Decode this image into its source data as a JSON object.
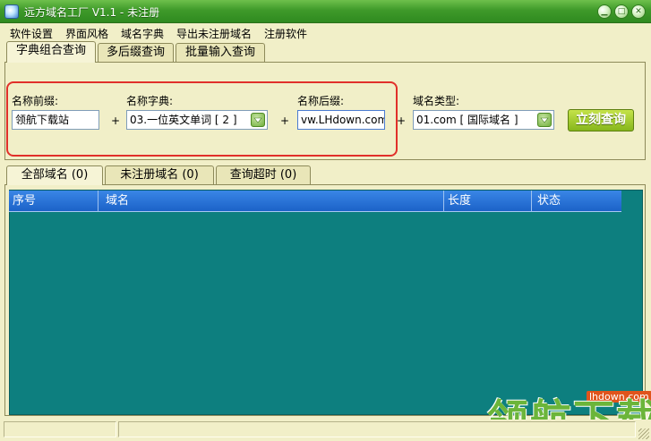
{
  "window": {
    "title": "远方域名工厂 V1.1 - 未注册",
    "icon": "app-icon",
    "buttons": [
      "minimize-icon",
      "maximize-icon",
      "close-icon"
    ]
  },
  "menu": {
    "items": [
      {
        "label": "软件设置"
      },
      {
        "label": "界面风格"
      },
      {
        "label": "域名字典"
      },
      {
        "label": "导出未注册域名"
      },
      {
        "label": "注册软件"
      }
    ]
  },
  "top_tabs": [
    {
      "label": "字典组合查询",
      "active": true
    },
    {
      "label": "多后缀查询",
      "active": false
    },
    {
      "label": "批量输入查询",
      "active": false
    }
  ],
  "form": {
    "prefix_label": "名称前缀:",
    "prefix_value": "领航下载站",
    "dict_label": "名称字典:",
    "dict_value": "03.一位英文单词 [ 2 ]",
    "suffix_label": "名称后缀:",
    "suffix_value": "vw.LHdown.com",
    "type_label": "域名类型:",
    "type_value": "01.com [ 国际域名 ]",
    "plus": "+",
    "query_button": "立刻查询"
  },
  "result_tabs": [
    {
      "label": "全部域名 (0)",
      "active": true
    },
    {
      "label": "未注册域名 (0)",
      "active": false
    },
    {
      "label": "查询超时 (0)",
      "active": false
    }
  ],
  "table": {
    "columns": [
      "序号",
      "域名",
      "长度",
      "状态"
    ],
    "rows": []
  },
  "watermark": {
    "url": "lhdown.com",
    "text": "领航下载"
  },
  "colors": {
    "titlebar": "#3f9a2a",
    "background": "#f1efc8",
    "list_background": "#0d7f7f",
    "header": "#1b62c8",
    "highlight": "#e1302a"
  }
}
